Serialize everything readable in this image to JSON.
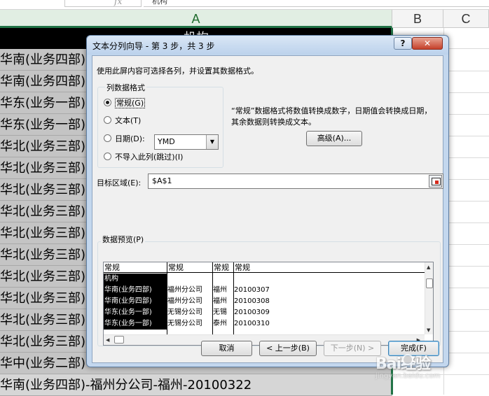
{
  "spreadsheet": {
    "formula_fx": "fx",
    "formula_value": "机构",
    "columns": [
      "A",
      "B",
      "C"
    ],
    "header_cell": "机构",
    "rows": [
      "华南(业务四部)",
      "华南(业务四部)",
      "华东(业务一部)",
      "华东(业务一部)",
      "华北(业务三部)",
      "华北(业务三部)",
      "华北(业务三部)",
      "华北(业务三部)",
      "华北(业务三部)",
      "华北(业务三部)",
      "华北(业务三部)",
      "华北(业务三部)",
      "华北(业务三部)",
      "华北(业务三部)",
      "华中(业务二部)",
      "华南(业务四部)-福州分公司-福州-20100322"
    ]
  },
  "dialog": {
    "title": "文本分列向导 - 第 3 步，共 3 步",
    "help_label": "?",
    "close_label": "✕",
    "instruction": "使用此屏内容可选择各列，并设置其数据格式。",
    "format_group_title": "列数据格式",
    "radio_general": "常规(G)",
    "radio_text": "文本(T)",
    "radio_date": "日期(D):",
    "date_format": "YMD",
    "radio_skip": "不导入此列(跳过)(I)",
    "description": "“常规”数据格式将数值转换成数字，日期值会转换成日期，其余数据则转换成文本。",
    "advanced_label": "高级(A)...",
    "destination_label": "目标区域(E):",
    "destination_value": "$A$1",
    "preview_title": "数据预览(P)",
    "preview_headers": [
      "常规",
      "常规",
      "常规",
      "常规"
    ],
    "preview_rows": [
      [
        "机构",
        "",
        "",
        ""
      ],
      [
        "华南(业务四部)",
        "福州分公司",
        "福州",
        "20100307"
      ],
      [
        "华南(业务四部)",
        "福州分公司",
        "福州",
        "20100308"
      ],
      [
        "华东(业务一部)",
        "无锡分公司",
        "无锡",
        "20100309"
      ],
      [
        "华东(业务一部)",
        "无锡分公司",
        "泰州",
        "20100310"
      ]
    ],
    "cancel_label": "取消",
    "back_label": "< 上一步(B)",
    "next_label": "下一步(N) >",
    "finish_label": "完成(F)"
  },
  "watermark": {
    "logo": "Bai经验",
    "sub": "jingyan.baidu.com"
  },
  "colors": {
    "selected_column_header": "#e1eee3",
    "selection_border": "#217346",
    "dialog_frame": "#c3d7ee",
    "close_button": "#c5402a"
  }
}
